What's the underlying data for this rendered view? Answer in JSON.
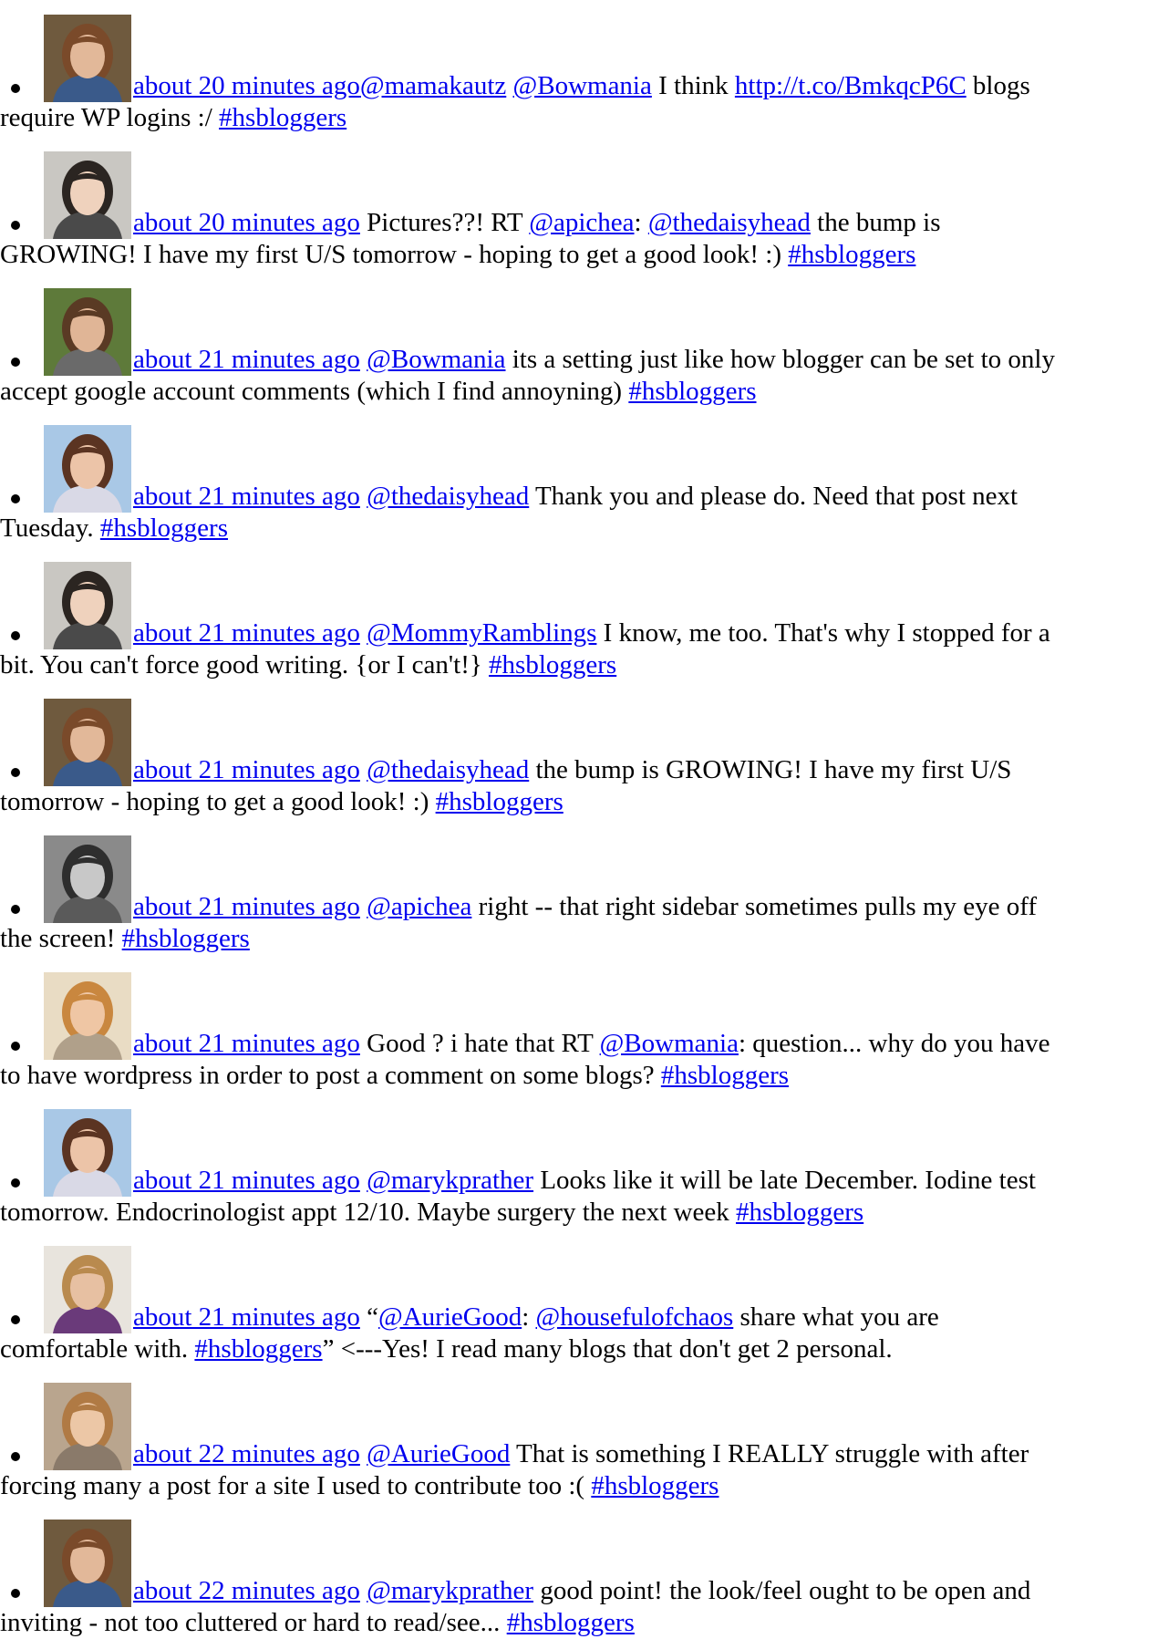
{
  "tweets": [
    {
      "avatar": {
        "bg": "#6f5a3e",
        "skin": "#e2b899",
        "hair": "#7a4a2a",
        "shirt": "#3a5a8a"
      },
      "time": "about 20 minutes ago",
      "line1": [
        {
          "t": "link",
          "v": "@mamakautz"
        },
        {
          "t": "text",
          "v": " "
        },
        {
          "t": "link",
          "v": "@Bowmania"
        },
        {
          "t": "text",
          "v": " I think "
        },
        {
          "t": "link",
          "v": "http://t.co/BmkqcP6C"
        },
        {
          "t": "text",
          "v": " blogs"
        }
      ],
      "line2": [
        {
          "t": "text",
          "v": "require WP logins :/ "
        },
        {
          "t": "link",
          "v": "#hsbloggers"
        }
      ]
    },
    {
      "avatar": {
        "bg": "#c9c7c2",
        "skin": "#efd2bd",
        "hair": "#2b2521",
        "shirt": "#4a4a4a"
      },
      "time": "about 20 minutes ago",
      "line1": [
        {
          "t": "text",
          "v": " Pictures??! RT "
        },
        {
          "t": "link",
          "v": "@apichea"
        },
        {
          "t": "text",
          "v": ": "
        },
        {
          "t": "link",
          "v": "@thedaisyhead"
        },
        {
          "t": "text",
          "v": " the bump is"
        }
      ],
      "line2": [
        {
          "t": "text",
          "v": "GROWING! I have my first U/S tomorrow - hoping to get a good look! :) "
        },
        {
          "t": "link",
          "v": "#hsbloggers"
        }
      ]
    },
    {
      "avatar": {
        "bg": "#5e7a3a",
        "skin": "#e0b596",
        "hair": "#5a3a24",
        "shirt": "#6a6a6a"
      },
      "time": "about 21 minutes ago",
      "line1": [
        {
          "t": "text",
          "v": " "
        },
        {
          "t": "link",
          "v": "@Bowmania"
        },
        {
          "t": "text",
          "v": " its a setting just like how blogger can be set to only"
        }
      ],
      "line2": [
        {
          "t": "text",
          "v": "accept google account comments (which I find annoyning) "
        },
        {
          "t": "link",
          "v": "#hsbloggers"
        }
      ]
    },
    {
      "avatar": {
        "bg": "#a9c8e6",
        "skin": "#ecc4a8",
        "hair": "#5b3422",
        "shirt": "#d9d9e6"
      },
      "time": "about 21 minutes ago",
      "line1": [
        {
          "t": "text",
          "v": " "
        },
        {
          "t": "link",
          "v": "@thedaisyhead"
        },
        {
          "t": "text",
          "v": " Thank you and please do. Need that post next"
        }
      ],
      "line2": [
        {
          "t": "text",
          "v": "Tuesday. "
        },
        {
          "t": "link",
          "v": "#hsbloggers"
        }
      ]
    },
    {
      "avatar": {
        "bg": "#c9c7c2",
        "skin": "#efd2bd",
        "hair": "#2b2521",
        "shirt": "#4a4a4a"
      },
      "time": "about 21 minutes ago",
      "line1": [
        {
          "t": "text",
          "v": " "
        },
        {
          "t": "link",
          "v": "@MommyRamblings"
        },
        {
          "t": "text",
          "v": " I know, me too. That's why I stopped for a"
        }
      ],
      "line2": [
        {
          "t": "text",
          "v": "bit. You can't force good writing. {or I can't!} "
        },
        {
          "t": "link",
          "v": "#hsbloggers"
        }
      ]
    },
    {
      "avatar": {
        "bg": "#6f5a3e",
        "skin": "#e2b899",
        "hair": "#7a4a2a",
        "shirt": "#3a5a8a"
      },
      "time": "about 21 minutes ago",
      "line1": [
        {
          "t": "text",
          "v": " "
        },
        {
          "t": "link",
          "v": "@thedaisyhead"
        },
        {
          "t": "text",
          "v": " the bump is GROWING! I have my first U/S"
        }
      ],
      "line2": [
        {
          "t": "text",
          "v": "tomorrow - hoping to get a good look! :) "
        },
        {
          "t": "link",
          "v": "#hsbloggers"
        }
      ]
    },
    {
      "avatar": {
        "bg": "#8a8a8a",
        "skin": "#c8c8c8",
        "hair": "#2e2e2e",
        "shirt": "#5a5a5a"
      },
      "time": "about 21 minutes ago",
      "line1": [
        {
          "t": "text",
          "v": " "
        },
        {
          "t": "link",
          "v": "@apichea"
        },
        {
          "t": "text",
          "v": " right -- that right sidebar sometimes pulls my eye off"
        }
      ],
      "line2": [
        {
          "t": "text",
          "v": "the screen! "
        },
        {
          "t": "link",
          "v": "#hsbloggers"
        }
      ]
    },
    {
      "avatar": {
        "bg": "#e9dcc4",
        "skin": "#efc6a4",
        "hair": "#c9873f",
        "shirt": "#b0a08a"
      },
      "time": "about 21 minutes ago",
      "line1": [
        {
          "t": "text",
          "v": " Good ? i hate that RT "
        },
        {
          "t": "link",
          "v": "@Bowmania"
        },
        {
          "t": "text",
          "v": ": question... why do you have"
        }
      ],
      "line2": [
        {
          "t": "text",
          "v": "to have wordpress in order to post a comment on some blogs? "
        },
        {
          "t": "link",
          "v": "#hsbloggers"
        }
      ]
    },
    {
      "avatar": {
        "bg": "#a9c8e6",
        "skin": "#ecc4a8",
        "hair": "#5b3422",
        "shirt": "#d9d9e6"
      },
      "time": "about 21 minutes ago",
      "line1": [
        {
          "t": "text",
          "v": " "
        },
        {
          "t": "link",
          "v": "@marykprather"
        },
        {
          "t": "text",
          "v": " Looks like it will be late December. Iodine test"
        }
      ],
      "line2": [
        {
          "t": "text",
          "v": "tomorrow. Endocrinologist appt 12/10. Maybe surgery the next week "
        },
        {
          "t": "link",
          "v": "#hsbloggers"
        }
      ]
    },
    {
      "avatar": {
        "bg": "#e8e4dd",
        "skin": "#e7c0a2",
        "hair": "#b98a4e",
        "shirt": "#6a3a7a"
      },
      "time": "about 21 minutes ago",
      "line1": [
        {
          "t": "text",
          "v": " “"
        },
        {
          "t": "link",
          "v": "@AurieGood"
        },
        {
          "t": "text",
          "v": ": "
        },
        {
          "t": "link",
          "v": "@housefulofchaos"
        },
        {
          "t": "text",
          "v": " share what you are"
        }
      ],
      "line2": [
        {
          "t": "text",
          "v": "comfortable with. "
        },
        {
          "t": "link",
          "v": "#hsbloggers"
        },
        {
          "t": "text",
          "v": "” <---Yes! I read many blogs that don't get 2 personal."
        }
      ]
    },
    {
      "avatar": {
        "bg": "#b9a58e",
        "skin": "#ecc7a6",
        "hair": "#b07a44",
        "shirt": "#8a7a6a"
      },
      "time": "about 22 minutes ago",
      "line1": [
        {
          "t": "text",
          "v": " "
        },
        {
          "t": "link",
          "v": "@AurieGood"
        },
        {
          "t": "text",
          "v": " That is something I REALLY struggle with after"
        }
      ],
      "line2": [
        {
          "t": "text",
          "v": "forcing many a post for a site I used to contribute too :( "
        },
        {
          "t": "link",
          "v": "#hsbloggers"
        }
      ]
    },
    {
      "avatar": {
        "bg": "#6f5a3e",
        "skin": "#e2b899",
        "hair": "#7a4a2a",
        "shirt": "#3a5a8a"
      },
      "time": "about 22 minutes ago",
      "line1": [
        {
          "t": "text",
          "v": " "
        },
        {
          "t": "link",
          "v": "@marykprather"
        },
        {
          "t": "text",
          "v": " good point! the look/feel ought to be open and"
        }
      ],
      "line2": [
        {
          "t": "text",
          "v": "inviting - not too cluttered or hard to read/see... "
        },
        {
          "t": "link",
          "v": "#hsbloggers"
        }
      ]
    }
  ]
}
